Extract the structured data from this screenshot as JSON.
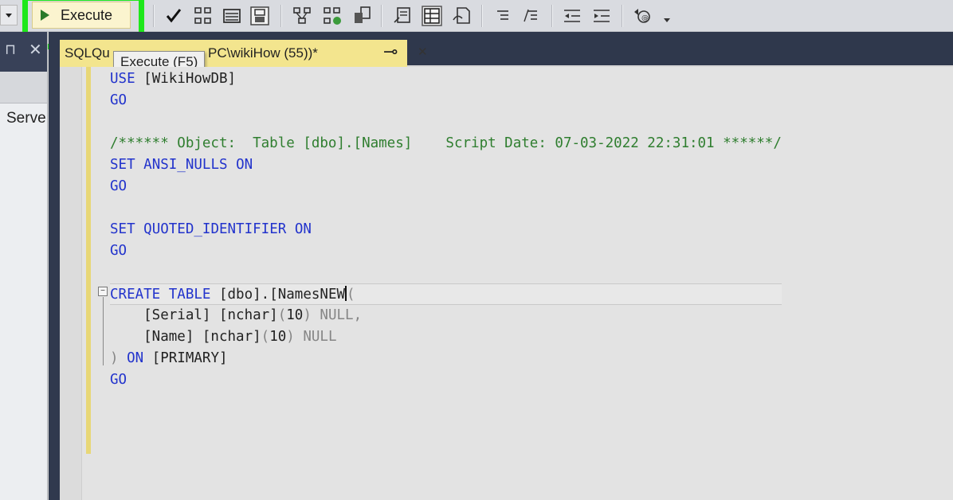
{
  "toolbar": {
    "execute_label": "Execute",
    "execute_tooltip": "Execute (F5)",
    "icons": [
      "dropdown-icon",
      "checkmark-icon",
      "parse-tree-icon",
      "display-plan-icon",
      "query-options-icon",
      "estimated-plan-icon",
      "include-stats-icon",
      "results-to-icon",
      "comment-icon",
      "uncomment-icon",
      "indent-icon",
      "outdent-icon",
      "specify-values-icon"
    ]
  },
  "left_panel": {
    "label": "Serve"
  },
  "tab": {
    "title_visible_start": "SQLQu",
    "title_visible_end": "PC\\wikiHow (55))*",
    "pin_glyph": "⊸",
    "close_glyph": "✕"
  },
  "code_lines": [
    {
      "parts": [
        {
          "t": "USE ",
          "c": "kw"
        },
        {
          "t": "[WikiHowDB]",
          "c": ""
        }
      ]
    },
    {
      "parts": [
        {
          "t": "GO",
          "c": "kw"
        }
      ]
    },
    {
      "parts": []
    },
    {
      "parts": [
        {
          "t": "/****** Object:  Table [dbo].[Names]    Script Date: 07-03-2022 22:31:01 ******/",
          "c": "cm"
        }
      ]
    },
    {
      "parts": [
        {
          "t": "SET ",
          "c": "kw"
        },
        {
          "t": "ANSI_NULLS ",
          "c": "kw"
        },
        {
          "t": "ON",
          "c": "kw"
        }
      ]
    },
    {
      "parts": [
        {
          "t": "GO",
          "c": "kw"
        }
      ]
    },
    {
      "parts": []
    },
    {
      "parts": [
        {
          "t": "SET ",
          "c": "kw"
        },
        {
          "t": "QUOTED_IDENTIFIER ",
          "c": "kw"
        },
        {
          "t": "ON",
          "c": "kw"
        }
      ]
    },
    {
      "parts": [
        {
          "t": "GO",
          "c": "kw"
        }
      ]
    },
    {
      "parts": []
    },
    {
      "parts": [
        {
          "t": "CREATE ",
          "c": "kw"
        },
        {
          "t": "TABLE ",
          "c": "kw"
        },
        {
          "t": "[dbo].[NamesNEW",
          "c": ""
        },
        {
          "t": "|CURSOR|",
          "c": "cursor"
        },
        {
          "t": "(",
          "c": "gr"
        }
      ],
      "highlight": true
    },
    {
      "parts": [
        {
          "t": "    [Serial] [nchar]",
          "c": ""
        },
        {
          "t": "(",
          "c": "gr"
        },
        {
          "t": "10",
          "c": ""
        },
        {
          "t": ") ",
          "c": "gr"
        },
        {
          "t": "NULL,",
          "c": "gr"
        }
      ]
    },
    {
      "parts": [
        {
          "t": "    [Name] [nchar]",
          "c": ""
        },
        {
          "t": "(",
          "c": "gr"
        },
        {
          "t": "10",
          "c": ""
        },
        {
          "t": ") ",
          "c": "gr"
        },
        {
          "t": "NULL",
          "c": "gr"
        }
      ]
    },
    {
      "parts": [
        {
          "t": ") ",
          "c": "gr"
        },
        {
          "t": "ON ",
          "c": "kw"
        },
        {
          "t": "[PRIMARY]",
          "c": ""
        }
      ]
    },
    {
      "parts": [
        {
          "t": "GO",
          "c": "kw"
        }
      ]
    }
  ]
}
